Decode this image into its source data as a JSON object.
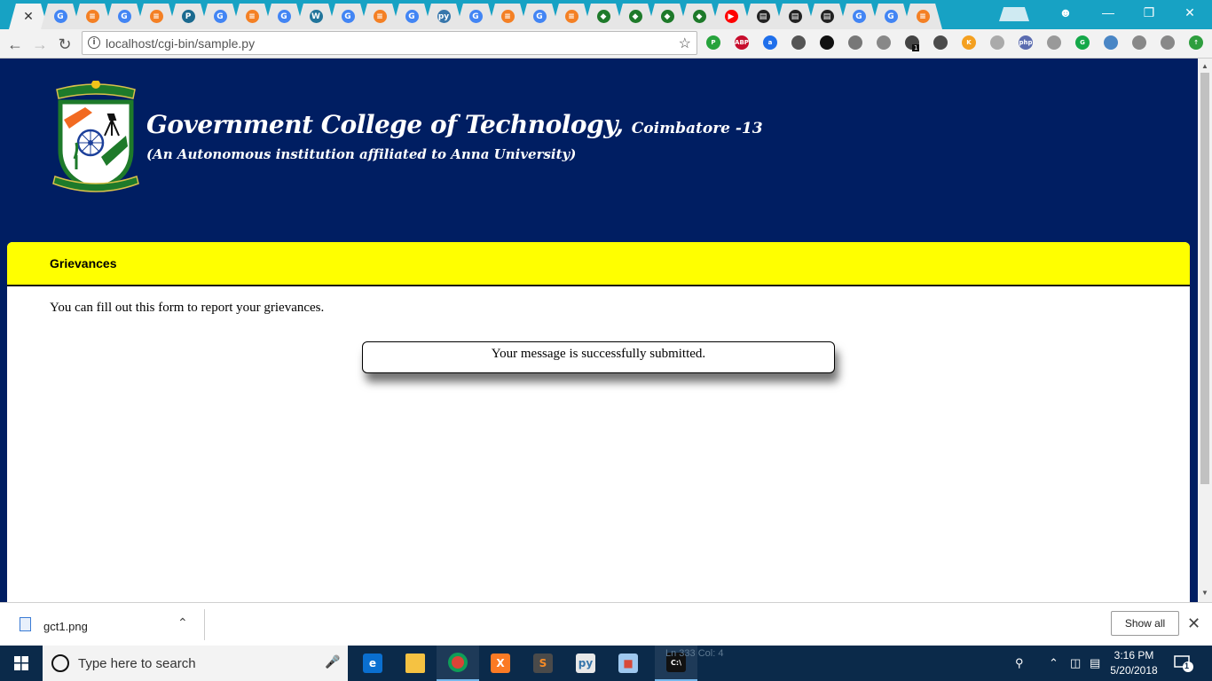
{
  "browser": {
    "tab_count_icons": [
      "close",
      "google",
      "stack",
      "google",
      "stack",
      "pyedit",
      "google",
      "stack",
      "google",
      "wordpress",
      "google",
      "stack",
      "google",
      "python",
      "google",
      "stack",
      "google",
      "stack",
      "gct",
      "gct",
      "gct",
      "gct",
      "youtube",
      "book",
      "book",
      "book",
      "google",
      "google",
      "stack"
    ],
    "address": "localhost/cgi-bin/sample.py",
    "extensions": [
      "pp",
      "ABP",
      "a",
      "pocket",
      "circle",
      "gear",
      "head",
      "cube",
      "evernote",
      "k",
      "shield",
      "php",
      "pen",
      "G",
      "monitor",
      "shield2",
      "puzzle",
      "up"
    ],
    "extension_badge": "1"
  },
  "site": {
    "title_main": "Government College of Technology,",
    "title_sub": "Coimbatore -13",
    "tagline": "(An Autonomous institution affiliated to Anna University)"
  },
  "panel": {
    "heading": "Grievances",
    "intro": "You can fill out this form to report your grievances.",
    "message": "Your message is successfully submitted."
  },
  "downloads": {
    "filename": "gct1.png",
    "show_all": "Show all"
  },
  "taskbar": {
    "search_placeholder": "Type here to search",
    "ghost_text": "Ln 333   Col: 4",
    "time": "3:16 PM",
    "date": "5/20/2018",
    "notification_count": "1"
  },
  "colors": {
    "page_bg": "#001e62",
    "panel_head": "#ffff00",
    "tabstrip": "#17a2c4"
  }
}
